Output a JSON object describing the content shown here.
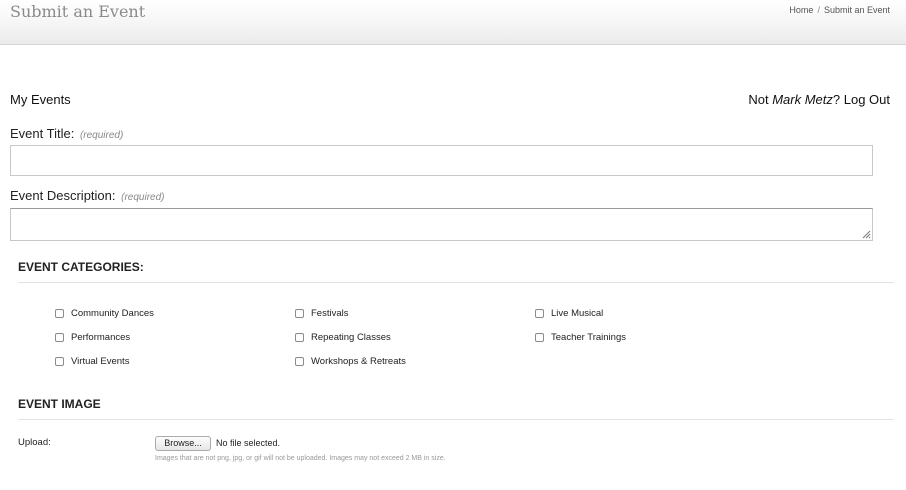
{
  "header": {
    "title": "Submit an Event",
    "breadcrumb": [
      "Home",
      "Submit an Event"
    ],
    "breadcrumb_separator": "/"
  },
  "nav": {
    "my_events": "My Events",
    "user_prefix": "Not ",
    "user_name": "Mark Metz",
    "user_suffix": "? ",
    "logout": "Log Out"
  },
  "form": {
    "title_label": "Event Title:",
    "title_required": "(required)",
    "title_value": "",
    "description_label": "Event Description:",
    "description_required": "(required)",
    "description_value": ""
  },
  "categories": {
    "heading": "EVENT CATEGORIES:",
    "items": [
      {
        "label": "Community Dances",
        "checked": false
      },
      {
        "label": "Festivals",
        "checked": false
      },
      {
        "label": "Live Musical",
        "checked": false
      },
      {
        "label": "Performances",
        "checked": false
      },
      {
        "label": "Repeating Classes",
        "checked": false
      },
      {
        "label": "Teacher Trainings",
        "checked": false
      },
      {
        "label": "Virtual Events",
        "checked": false
      },
      {
        "label": "Workshops & Retreats",
        "checked": false
      }
    ]
  },
  "image": {
    "heading": "EVENT IMAGE",
    "upload_label": "Upload:",
    "browse_label": "Browse...",
    "file_status": "No file selected.",
    "hint": "Images that are not png, jpg, or gif will not be uploaded. Images may not exceed 2 MB in size."
  },
  "icons": {
    "checkbox": "checkbox-icon",
    "resize": "resize-grip-icon"
  }
}
